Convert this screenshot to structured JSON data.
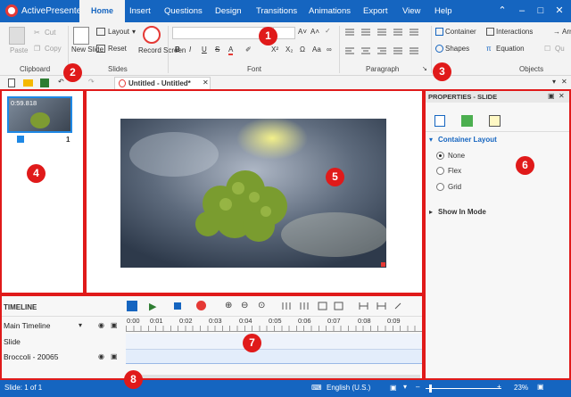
{
  "app": {
    "name": "ActivePresenter"
  },
  "ribbon_tabs": [
    "Home",
    "Insert",
    "Questions",
    "Design",
    "Transitions",
    "Animations",
    "Export",
    "View",
    "Help"
  ],
  "clipboard": {
    "paste": "Paste",
    "cut": "Cut",
    "copy": "Copy",
    "group": "Clipboard"
  },
  "slides": {
    "new_slide": "New Slide",
    "layout": "Layout",
    "reset": "Reset",
    "record_screen": "Record Screen",
    "group": "Slides"
  },
  "font": {
    "group": "Font"
  },
  "paragraph": {
    "group": "Paragraph"
  },
  "objects": {
    "container": "Container",
    "interactions": "Interactions",
    "shapes": "Shapes",
    "equation": "Equation",
    "arr": "Arr",
    "qu": "Qu",
    "group": "Objects"
  },
  "document": {
    "tab_title": "Untitled - Untitled*"
  },
  "thumbnail": {
    "duration": "0:59.818",
    "slide_number": "1"
  },
  "properties": {
    "title": "PROPERTIES - SLIDE",
    "section": "Container Layout",
    "options": [
      "None",
      "Flex",
      "Grid"
    ],
    "selected": "None",
    "show_in_mode": "Show In Mode"
  },
  "timeline": {
    "title": "TIMELINE",
    "main": "Main Timeline",
    "rows": [
      "Slide",
      "Broccoli - 20065"
    ],
    "ticks": [
      "0:00",
      "0:01",
      "0:02",
      "0:03",
      "0:04",
      "0:05",
      "0:06",
      "0:07",
      "0:08",
      "0:09"
    ]
  },
  "status": {
    "slide": "Slide: 1 of 1",
    "language": "English (U.S.)",
    "zoom": "23%"
  },
  "annotations": [
    "1",
    "2",
    "3",
    "4",
    "5",
    "6",
    "7",
    "8"
  ],
  "colors": {
    "accent": "#1565c0",
    "highlight": "#e01a1a"
  }
}
